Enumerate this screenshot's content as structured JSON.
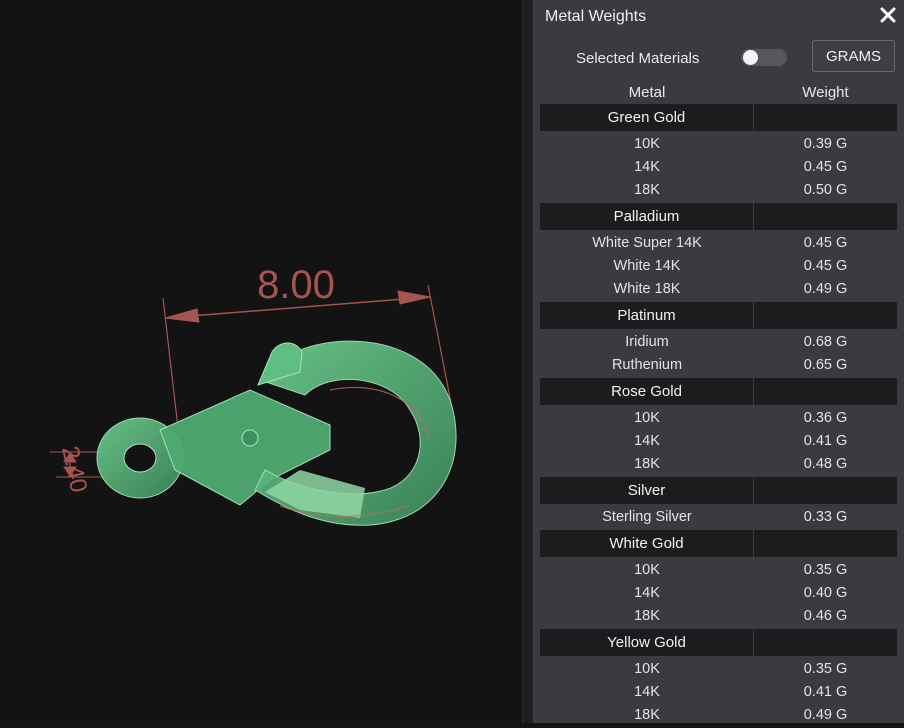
{
  "viewport": {
    "dimension_width": "8.00",
    "dimension_height": "2.40",
    "accent_color": "#b85a55",
    "model_color": "#5fbf82"
  },
  "panel": {
    "title": "Metal Weights",
    "close_icon": "close-icon",
    "selected_materials_label": "Selected Materials",
    "selected_materials_on": false,
    "units_button": "GRAMS",
    "columns": [
      "Metal",
      "Weight"
    ]
  },
  "groups": [
    {
      "name": "Green Gold",
      "items": [
        {
          "label": "10K",
          "weight": "0.39 G"
        },
        {
          "label": "14K",
          "weight": "0.45 G"
        },
        {
          "label": "18K",
          "weight": "0.50 G"
        }
      ]
    },
    {
      "name": "Palladium",
      "items": [
        {
          "label": "White Super 14K",
          "weight": "0.45 G"
        },
        {
          "label": "White 14K",
          "weight": "0.45 G"
        },
        {
          "label": "White 18K",
          "weight": "0.49 G"
        }
      ]
    },
    {
      "name": "Platinum",
      "items": [
        {
          "label": "Iridium",
          "weight": "0.68 G"
        },
        {
          "label": "Ruthenium",
          "weight": "0.65 G"
        }
      ]
    },
    {
      "name": "Rose Gold",
      "items": [
        {
          "label": "10K",
          "weight": "0.36 G"
        },
        {
          "label": "14K",
          "weight": "0.41 G"
        },
        {
          "label": "18K",
          "weight": "0.48 G"
        }
      ]
    },
    {
      "name": "Silver",
      "items": [
        {
          "label": "Sterling Silver",
          "weight": "0.33 G"
        }
      ]
    },
    {
      "name": "White Gold",
      "items": [
        {
          "label": "10K",
          "weight": "0.35 G"
        },
        {
          "label": "14K",
          "weight": "0.40 G"
        },
        {
          "label": "18K",
          "weight": "0.46 G"
        }
      ]
    },
    {
      "name": "Yellow Gold",
      "items": [
        {
          "label": "10K",
          "weight": "0.35 G"
        },
        {
          "label": "14K",
          "weight": "0.41 G"
        },
        {
          "label": "18K",
          "weight": "0.49 G"
        }
      ]
    }
  ]
}
